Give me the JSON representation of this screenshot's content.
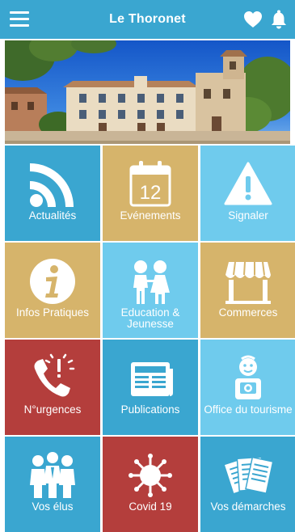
{
  "header": {
    "title": "Le Thoronet",
    "menu_icon": "hamburger-menu-icon",
    "favorite_icon": "heart-icon",
    "notification_icon": "bell-icon",
    "color": "#3aa6d0"
  },
  "hero": {
    "image": "town-hall-photo"
  },
  "tiles": [
    {
      "label": "Actualités",
      "icon": "rss-feed-icon",
      "color": "#3aa6d0"
    },
    {
      "label": "Evénements",
      "icon": "calendar-icon",
      "day": "12",
      "color": "#d6b46b"
    },
    {
      "label": "Signaler",
      "icon": "warning-icon",
      "color": "#6fcbed"
    },
    {
      "label": "Infos Pratiques",
      "icon": "info-icon",
      "color": "#d6b46b"
    },
    {
      "label": "Education & Jeunesse",
      "icon": "children-icon",
      "color": "#6fcbed"
    },
    {
      "label": "Commerces",
      "icon": "shop-icon",
      "color": "#d6b46b"
    },
    {
      "label": "N°urgences",
      "icon": "emergency-phone-icon",
      "color": "#b43e3c"
    },
    {
      "label": "Publications",
      "icon": "newspaper-icon",
      "color": "#3aa6d0"
    },
    {
      "label": "Office du tourisme",
      "icon": "tourist-icon",
      "color": "#6fcbed"
    },
    {
      "label": "Vos élus",
      "icon": "elected-officials-icon",
      "color": "#3aa6d0"
    },
    {
      "label": "Covid 19",
      "icon": "virus-icon",
      "color": "#b43e3c"
    },
    {
      "label": "Vos démarches",
      "icon": "documents-icon",
      "color": "#3aa6d0"
    }
  ]
}
